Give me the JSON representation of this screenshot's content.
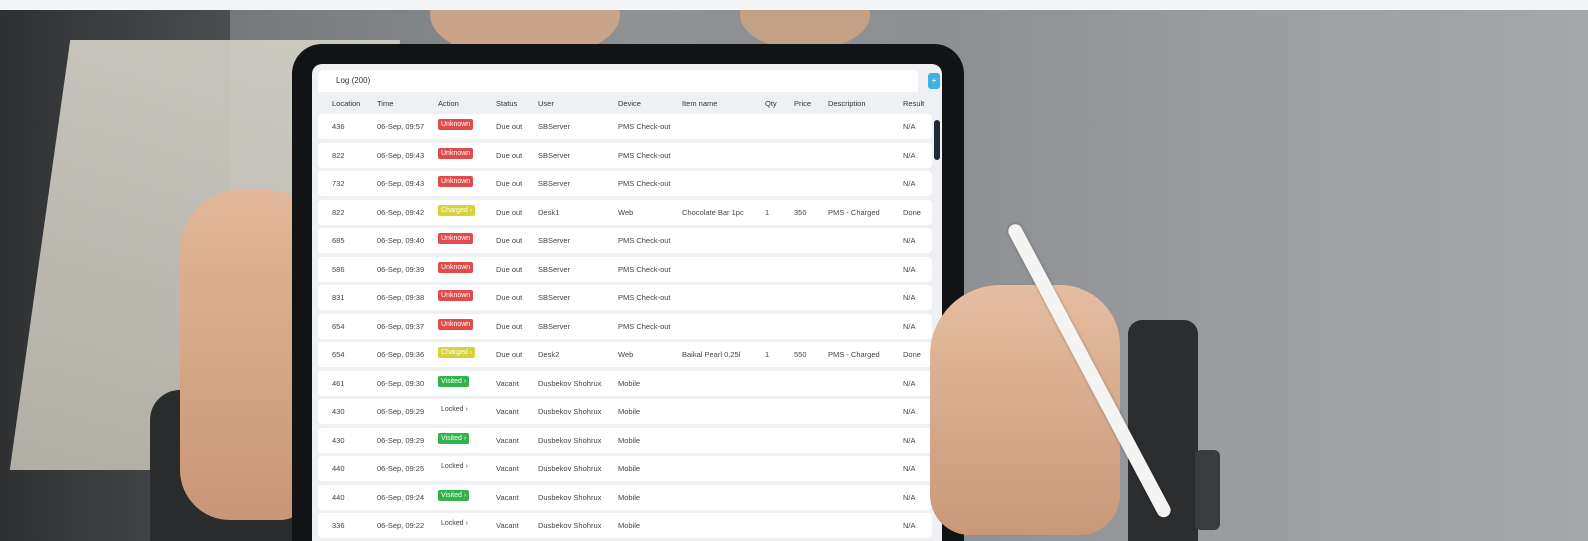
{
  "log": {
    "title": "Log (200)",
    "add_label": "+"
  },
  "columns": [
    "Location",
    "Time",
    "Action",
    "Status",
    "User",
    "Device",
    "Item name",
    "Qty",
    "Price",
    "Description",
    "Result"
  ],
  "rows": [
    {
      "location": "436",
      "time": "06-Sep, 09:57",
      "action": "Unknown",
      "status": "Due out",
      "user": "SBServer",
      "device": "PMS Check-out",
      "item": "",
      "qty": "",
      "price": "",
      "description": "",
      "result": "N/A"
    },
    {
      "location": "822",
      "time": "06-Sep, 09:43",
      "action": "Unknown",
      "status": "Due out",
      "user": "SBServer",
      "device": "PMS Check-out",
      "item": "",
      "qty": "",
      "price": "",
      "description": "",
      "result": "N/A"
    },
    {
      "location": "732",
      "time": "06-Sep, 09:43",
      "action": "Unknown",
      "status": "Due out",
      "user": "SBServer",
      "device": "PMS Check-out",
      "item": "",
      "qty": "",
      "price": "",
      "description": "",
      "result": "N/A"
    },
    {
      "location": "822",
      "time": "06-Sep, 09:42",
      "action": "Charged ›",
      "status": "Due out",
      "user": "Desk1",
      "device": "Web",
      "item": "Chocolate Bar 1pc",
      "qty": "1",
      "price": "350",
      "description": "PMS - Charged",
      "result": "Done"
    },
    {
      "location": "685",
      "time": "06-Sep, 09:40",
      "action": "Unknown",
      "status": "Due out",
      "user": "SBServer",
      "device": "PMS Check-out",
      "item": "",
      "qty": "",
      "price": "",
      "description": "",
      "result": "N/A"
    },
    {
      "location": "586",
      "time": "06-Sep, 09:39",
      "action": "Unknown",
      "status": "Due out",
      "user": "SBServer",
      "device": "PMS Check-out",
      "item": "",
      "qty": "",
      "price": "",
      "description": "",
      "result": "N/A"
    },
    {
      "location": "831",
      "time": "06-Sep, 09:38",
      "action": "Unknown",
      "status": "Due out",
      "user": "SBServer",
      "device": "PMS Check-out",
      "item": "",
      "qty": "",
      "price": "",
      "description": "",
      "result": "N/A"
    },
    {
      "location": "654",
      "time": "06-Sep, 09:37",
      "action": "Unknown",
      "status": "Due out",
      "user": "SBServer",
      "device": "PMS Check-out",
      "item": "",
      "qty": "",
      "price": "",
      "description": "",
      "result": "N/A"
    },
    {
      "location": "654",
      "time": "06-Sep, 09:36",
      "action": "Charged ›",
      "status": "Due out",
      "user": "Desk2",
      "device": "Web",
      "item": "Baikal Pearl 0,25l",
      "qty": "1",
      "price": "550",
      "description": "PMS - Charged",
      "result": "Done"
    },
    {
      "location": "461",
      "time": "06-Sep, 09:30",
      "action": "Visited ›",
      "status": "Vacant",
      "user": "Dusbekov Shohrux",
      "device": "Mobile",
      "item": "",
      "qty": "",
      "price": "",
      "description": "",
      "result": "N/A"
    },
    {
      "location": "430",
      "time": "06-Sep, 09:29",
      "action": "Locked ›",
      "status": "Vacant",
      "user": "Dusbekov Shohrux",
      "device": "Mobile",
      "item": "",
      "qty": "",
      "price": "",
      "description": "",
      "result": "N/A"
    },
    {
      "location": "430",
      "time": "06-Sep, 09:29",
      "action": "Visited ›",
      "status": "Vacant",
      "user": "Dusbekov Shohrux",
      "device": "Mobile",
      "item": "",
      "qty": "",
      "price": "",
      "description": "",
      "result": "N/A"
    },
    {
      "location": "440",
      "time": "06-Sep, 09:25",
      "action": "Locked ›",
      "status": "Vacant",
      "user": "Dusbekov Shohrux",
      "device": "Mobile",
      "item": "",
      "qty": "",
      "price": "",
      "description": "",
      "result": "N/A"
    },
    {
      "location": "440",
      "time": "06-Sep, 09:24",
      "action": "Visited ›",
      "status": "Vacant",
      "user": "Dusbekov Shohrux",
      "device": "Mobile",
      "item": "",
      "qty": "",
      "price": "",
      "description": "",
      "result": "N/A"
    },
    {
      "location": "336",
      "time": "06-Sep, 09:22",
      "action": "Locked ›",
      "status": "Vacant",
      "user": "Dusbekov Shohrux",
      "device": "Mobile",
      "item": "",
      "qty": "",
      "price": "",
      "description": "",
      "result": "N/A"
    }
  ],
  "colors": {
    "unknown": "#e24b4b",
    "charged": "#d4d43a",
    "visited": "#2fb34a",
    "accent": "#3cb3e0"
  }
}
